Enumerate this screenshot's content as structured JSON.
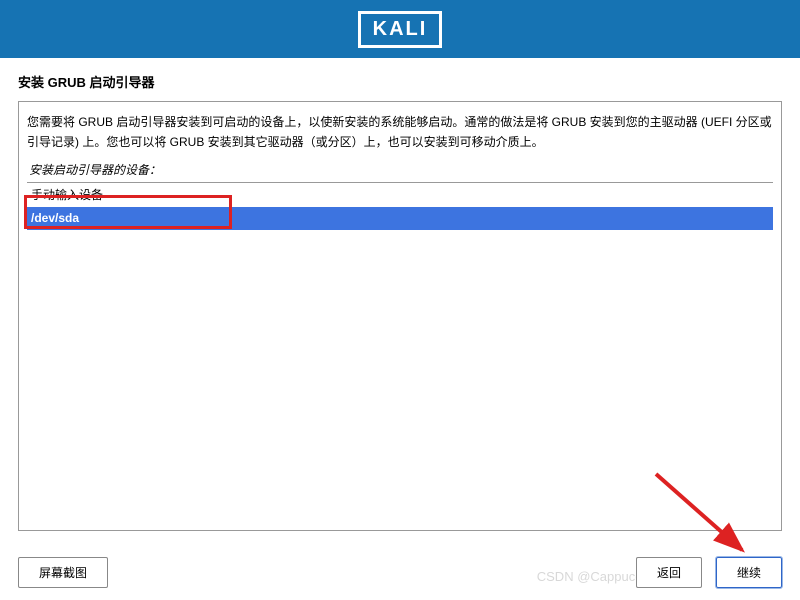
{
  "header": {
    "logo_text": "KALI"
  },
  "page": {
    "title": "安装 GRUB 启动引导器"
  },
  "instruction": {
    "text": "您需要将 GRUB 启动引导器安装到可启动的设备上，以使新安装的系统能够启动。通常的做法是将 GRUB 安装到您的主驱动器 (UEFI 分区或引导记录) 上。您也可以将 GRUB 安装到其它驱动器（或分区）上，也可以安装到可移动介质上。"
  },
  "field_label": "安装启动引导器的设备：",
  "options": {
    "manual": "手动输入设备",
    "selected": "/dev/sda"
  },
  "footer": {
    "screenshot": "屏幕截图",
    "back": "返回",
    "continue": "继续"
  },
  "watermark": "CSDN @Cappuccino-jay"
}
